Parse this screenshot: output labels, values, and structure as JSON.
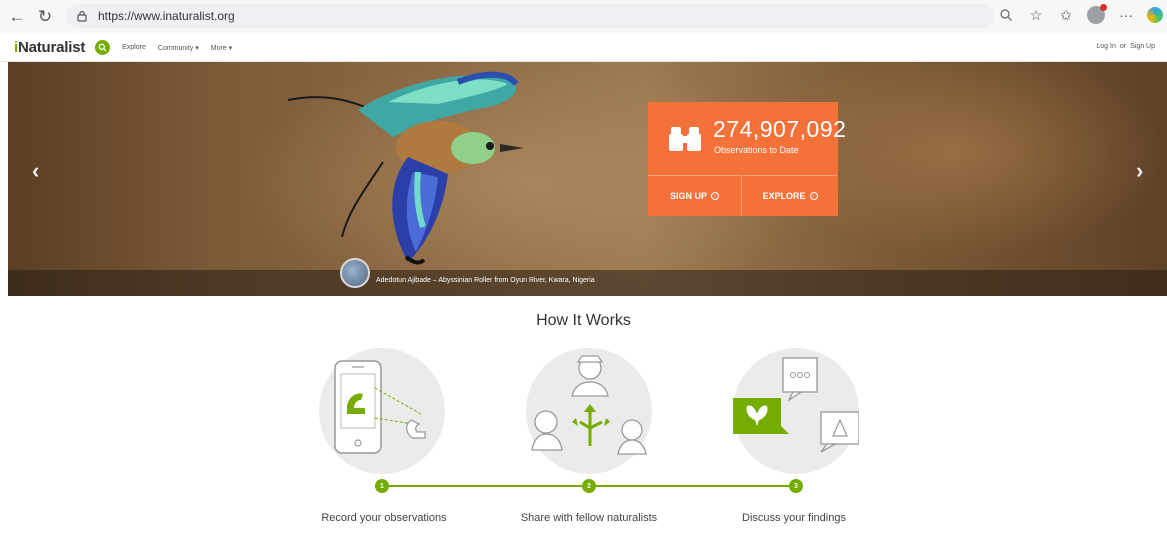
{
  "browser": {
    "url": "https://www.inaturalist.org"
  },
  "header": {
    "logo_prefix": "i",
    "logo_rest": "Naturalist",
    "nav": [
      {
        "label": "Explore"
      },
      {
        "label": "Community ▾"
      },
      {
        "label": "More ▾"
      }
    ],
    "login": "Log In",
    "or": "or",
    "signup": "Sign Up"
  },
  "hero": {
    "observations_count": "274,907,092",
    "observations_label": "Observations to Date",
    "signup_label": "SIGN UP",
    "explore_label": "EXPLORE",
    "credit_user": "Adedotun Ajibade",
    "credit_separator": "–",
    "credit_caption": "Abyssinian Roller from Oyun River, Kwara, Nigeria",
    "prev_icon": "chevron-left-icon",
    "next_icon": "chevron-right-icon"
  },
  "how_it_works": {
    "title": "How It Works",
    "steps": [
      {
        "number": "1",
        "label": "Record your observations"
      },
      {
        "number": "2",
        "label": "Share with fellow naturalists"
      },
      {
        "number": "3",
        "label": "Discuss your findings"
      }
    ]
  },
  "colors": {
    "brand_green": "#74ac00",
    "obs_orange": "#f5713a"
  }
}
